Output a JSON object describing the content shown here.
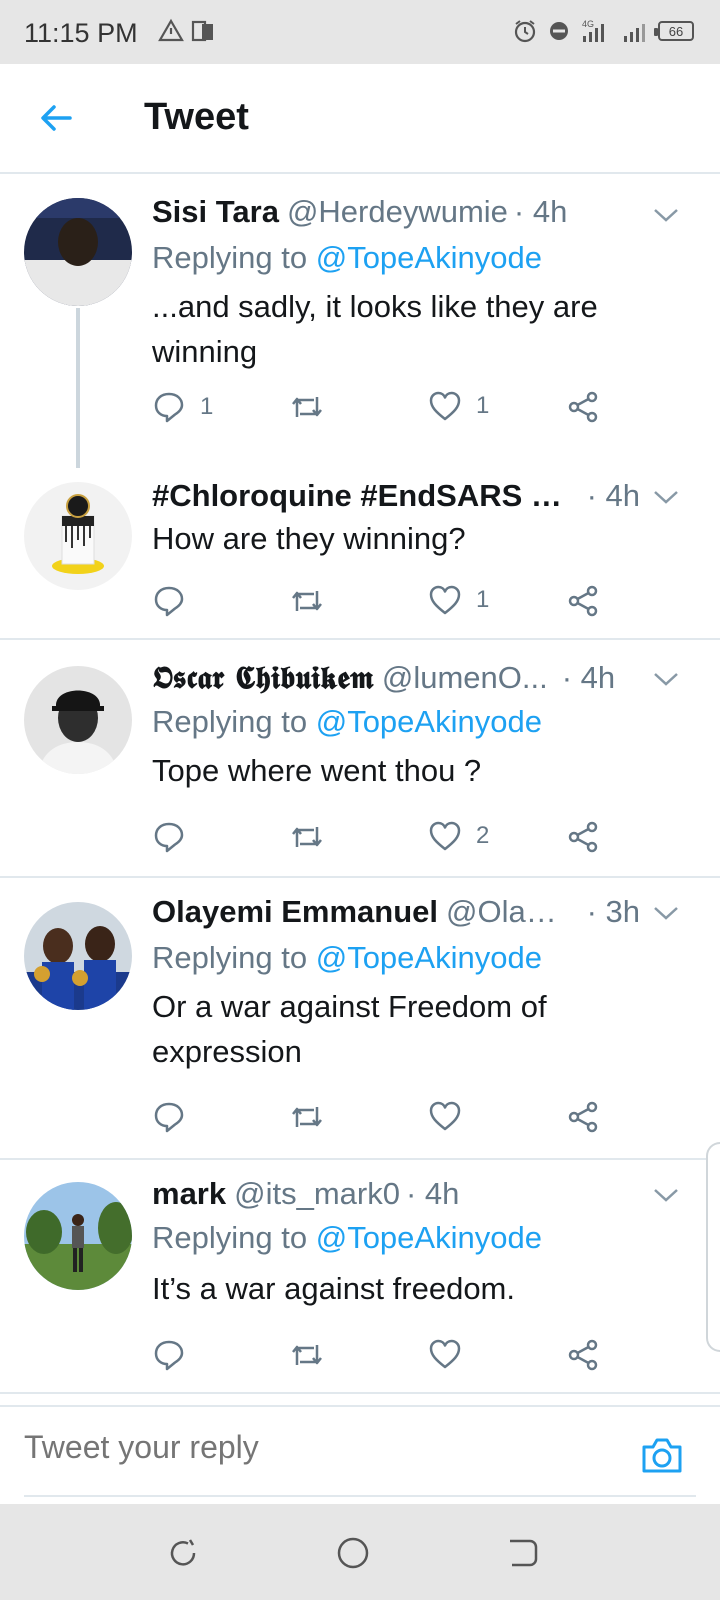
{
  "status_bar": {
    "time": "11:15 PM",
    "battery": "66",
    "network": "4G"
  },
  "header": {
    "title": "Tweet"
  },
  "tweets": [
    {
      "name": "Sisi Tara",
      "handle": "@Herdeywumie",
      "time": "· 4h",
      "reply_prefix": "Replying to",
      "reply_to": "@TopeAkinyode",
      "text": "...and sadly, it looks like they are winning",
      "reply_count": "1",
      "retweet_count": "",
      "like_count": "1"
    },
    {
      "name": "#Chloroquine #EndSARS #...",
      "handle": "",
      "time": "· 4h",
      "text": "How are they winning?",
      "reply_count": "",
      "retweet_count": "",
      "like_count": "1"
    },
    {
      "name": "𝕺𝖘𝖈𝖆𝖗 𝕮𝖍𝖎𝖇𝖚𝖎𝖐𝖊𝖒",
      "handle": "@lumenO...",
      "time": "· 4h",
      "reply_prefix": "Replying to",
      "reply_to": "@TopeAkinyode",
      "text": "Tope where went thou ?",
      "reply_count": "",
      "retweet_count": "",
      "like_count": "2"
    },
    {
      "name": "Olayemi Emmanuel",
      "handle": "@Olay...",
      "time": "· 3h",
      "reply_prefix": "Replying to",
      "reply_to": "@TopeAkinyode",
      "text": "Or a war against Freedom of expression",
      "reply_count": "",
      "retweet_count": "",
      "like_count": ""
    },
    {
      "name": "mark",
      "handle": "@its_mark0",
      "time": "· 4h",
      "reply_prefix": "Replying to",
      "reply_to": "@TopeAkinyode",
      "text": "It’s a war against freedom.",
      "reply_count": "",
      "retweet_count": "",
      "like_count": ""
    }
  ],
  "reply_bar": {
    "placeholder": "Tweet your reply"
  },
  "colors": {
    "accent": "#1da1f2",
    "muted": "#657786",
    "text": "#14171a",
    "divider": "#e1e8ed"
  }
}
